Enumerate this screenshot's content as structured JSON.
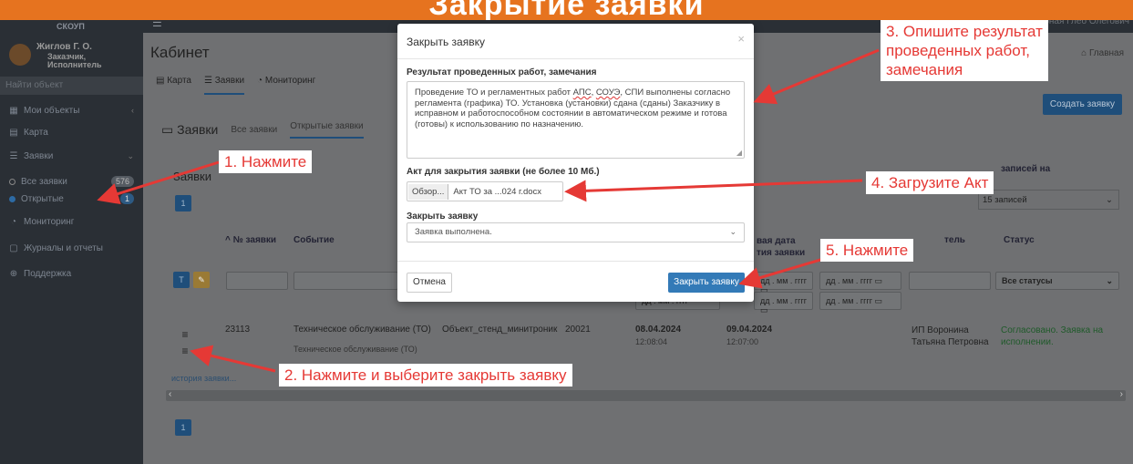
{
  "banner": {
    "text": "Закрытие заявки"
  },
  "sidebar": {
    "logo": "СКОУП",
    "user_name": "Жиглов Г. О.",
    "user_role_1": "Заказчик,",
    "user_role_2": "Исполнитель",
    "search_placeholder": "Найти объект",
    "items": [
      {
        "label": "Мои объекты"
      },
      {
        "label": "Карта"
      },
      {
        "label": "Заявки"
      },
      {
        "label": "Все заявки",
        "badge": "576"
      },
      {
        "label": "Открытые",
        "badge": "1"
      },
      {
        "label": "Мониторинг"
      },
      {
        "label": "Журналы и отчеты"
      },
      {
        "label": "Поддержка"
      }
    ]
  },
  "topbar": {
    "user": "Зборная Глеб Олегович"
  },
  "page": {
    "title": "Кабинет",
    "home": "Главная",
    "tabs": [
      {
        "label": "Карта"
      },
      {
        "label": "Заявки"
      },
      {
        "label": "Мониторинг"
      }
    ],
    "section_title": "Заявки",
    "section_tabs": [
      {
        "label": "Все заявки"
      },
      {
        "label": "Открытые заявки"
      }
    ],
    "create_button": "Создать заявку",
    "zayavki_label": "Заявки",
    "records_label": "записей на",
    "records_select": "15 записей",
    "page_num": "1"
  },
  "table": {
    "headers": {
      "num": "^ № заявки",
      "event": "Событие",
      "date1_a": "вая дата",
      "date1_b": "тия заявки",
      "executor": "тель",
      "status": "Статус"
    },
    "filters": {
      "date_ph": "дд . мм . гггг",
      "status": "Все статусы"
    },
    "row": {
      "num": "23113",
      "event": "Техническое обслуживание (ТО)",
      "event_sub": "Техническое обслуживание (ТО)",
      "object": "Объект_стенд_минитроник",
      "code": "20021",
      "date1": "08.04.2024",
      "time1": "12:08:04",
      "date2": "09.04.2024",
      "time2": "12:07:00",
      "executor_1": "ИП Воронина",
      "executor_2": "Татьяна Петровна",
      "status_1": "Согласовано. Заявка на",
      "status_2": "исполнении."
    },
    "history": "история заявки..."
  },
  "modal": {
    "title": "Закрыть заявку",
    "close_x": "×",
    "result_label": "Результат проведенных работ, замечания",
    "result_text_1": "Проведение ТО и регламентных работ ",
    "result_apc": "АПС",
    "result_text_2": ", ",
    "result_soue": "СОУЭ",
    "result_text_3": ", СПИ выполнены согласно регламента (графика) ТО. Установка (установки) сдана (сданы) Заказчику в исправном и работоспособном состоянии в автоматическом режиме и готова (готовы) к использованию по назначению.",
    "act_label": "Акт для закрытия заявки (не более 10 Мб.)",
    "browse": "Обзор...",
    "file_name": "Акт ТО за ...024 г.docx",
    "close_label": "Закрыть заявку",
    "close_select": "Заявка выполнена.",
    "cancel": "Отмена",
    "submit": "Закрыть заявку"
  },
  "callouts": {
    "c1": "1. Нажмите",
    "c2": "2. Нажмите и выберите закрыть заявку",
    "c3_1": "3. Опишите результат",
    "c3_2": "проведенных работ,",
    "c3_3": "замечания",
    "c4": "4. Загрузите Акт",
    "c5": "5. Нажмите"
  },
  "colors": {
    "accent": "#e6731f",
    "primary": "#337ab7",
    "callout_text": "#e53935"
  }
}
